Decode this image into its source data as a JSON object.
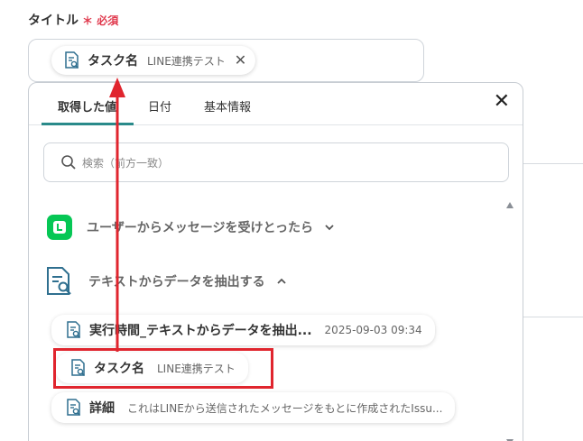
{
  "field": {
    "label": "タイトル",
    "required_mark": "＊",
    "required_text": "必須",
    "chip_name": "タスク名",
    "chip_sub": "LINE連携テスト",
    "chip_close": "✕"
  },
  "panel": {
    "tabs": [
      {
        "label": "取得した値",
        "active": true
      },
      {
        "label": "日付",
        "active": false
      },
      {
        "label": "基本情報",
        "active": false
      }
    ],
    "close": "✕",
    "search_placeholder": "検索（前方一致）"
  },
  "sections": [
    {
      "label": "ユーザーからメッセージを受けとったら",
      "icon": "line-logo-icon",
      "expanded": false
    },
    {
      "label": "テキストからデータを抽出する",
      "icon": "document-search-icon",
      "expanded": true
    }
  ],
  "items": [
    {
      "name": "実行時間_テキストからデータを抽出...",
      "sub": "2025-09-03 09:34"
    },
    {
      "name": "タスク名",
      "sub": "LINE連携テスト"
    },
    {
      "name": "詳細",
      "sub": "これはLINEから送信されたメッセージをもとに作成されたIssu..."
    }
  ],
  "colors": {
    "accent": "#2a8a8a",
    "required": "#e0384c",
    "line_green": "#06c755",
    "annotation_red": "#e0252e"
  }
}
